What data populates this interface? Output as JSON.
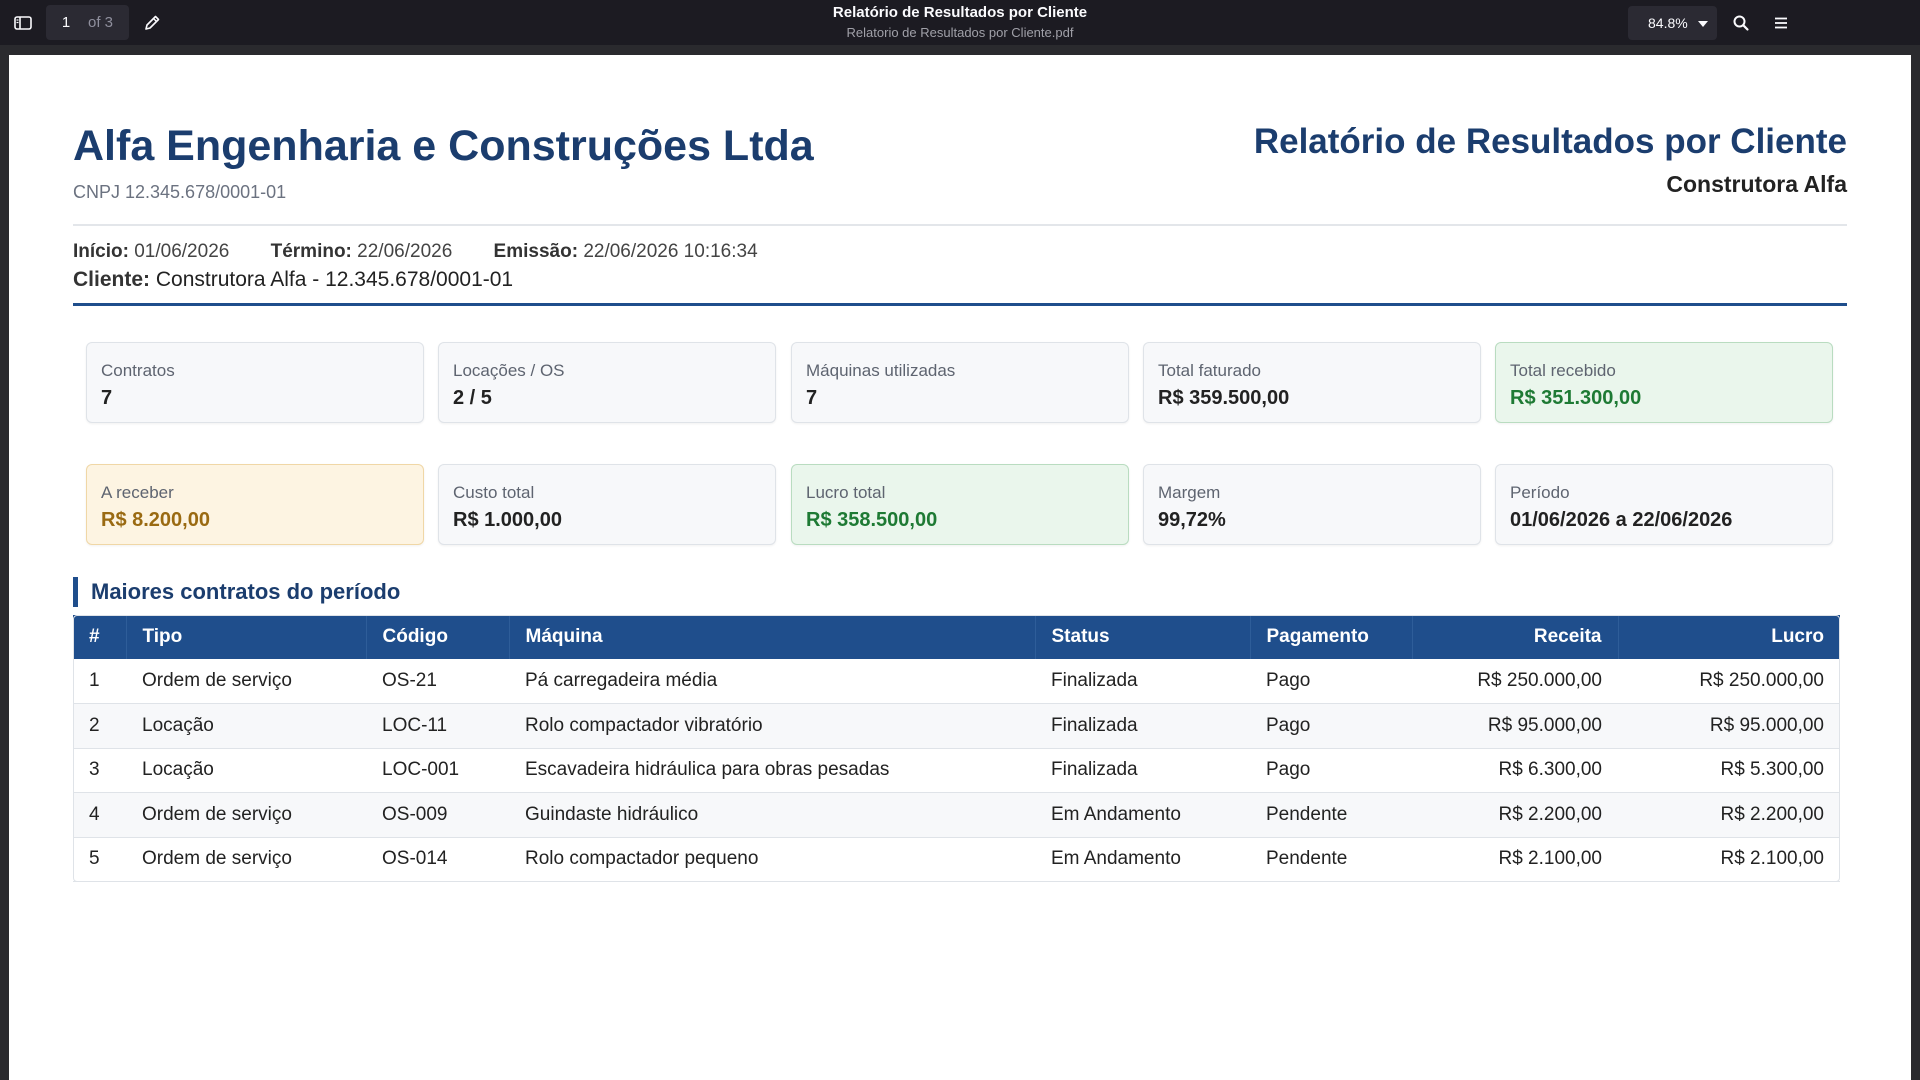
{
  "toolbar": {
    "page_current": "1",
    "page_total_label": "of 3",
    "title": "Relatório de Resultados por Cliente",
    "filename": "Relatorio de Resultados por Cliente.pdf",
    "zoom": "84.8%",
    "icons": {
      "sidebar": "sidebar-toggle-icon",
      "edit": "pencil-icon",
      "search": "search-icon",
      "menu": "hamburger-menu-icon"
    }
  },
  "report": {
    "company_name": "Alfa Engenharia e Construções Ltda",
    "company_cnpj": "CNPJ 12.345.678/0001-01",
    "title": "Relatório de Resultados por Cliente",
    "client_short": "Construtora Alfa",
    "meta": {
      "start_label": "Início:",
      "start_value": "01/06/2026",
      "end_label": "Término:",
      "end_value": "22/06/2026",
      "issued_label": "Emissão:",
      "issued_value": "22/06/2026 10:16:34",
      "client_label": "Cliente:",
      "client_value": "Construtora Alfa - 12.345.678/0001-01"
    },
    "cards": [
      {
        "label": "Contratos",
        "value": "7"
      },
      {
        "label": "Locações / OS",
        "value": "2 / 5"
      },
      {
        "label": "Máquinas utilizadas",
        "value": "7"
      },
      {
        "label": "Total faturado",
        "value": "R$ 359.500,00"
      },
      {
        "label": "Total recebido",
        "value": "R$ 351.300,00"
      },
      {
        "label": "A receber",
        "value": "R$ 8.200,00"
      },
      {
        "label": "Custo total",
        "value": "R$ 1.000,00"
      },
      {
        "label": "Lucro total",
        "value": "R$ 358.500,00"
      },
      {
        "label": "Margem",
        "value": "99,72%"
      },
      {
        "label": "Período",
        "value": "01/06/2026 a 22/06/2026"
      }
    ],
    "section_title": "Maiores contratos do período",
    "table": {
      "headers": [
        "#",
        "Tipo",
        "Código",
        "Máquina",
        "Status",
        "Pagamento",
        "Receita",
        "Lucro"
      ],
      "rows": [
        [
          "1",
          "Ordem de serviço",
          "OS-21",
          "Pá carregadeira média",
          "Finalizada",
          "Pago",
          "R$ 250.000,00",
          "R$ 250.000,00"
        ],
        [
          "2",
          "Locação",
          "LOC-11",
          "Rolo compactador vibratório",
          "Finalizada",
          "Pago",
          "R$ 95.000,00",
          "R$ 95.000,00"
        ],
        [
          "3",
          "Locação",
          "LOC-001",
          "Escavadeira hidráulica para obras pesadas",
          "Finalizada",
          "Pago",
          "R$ 6.300,00",
          "R$ 5.300,00"
        ],
        [
          "4",
          "Ordem de serviço",
          "OS-009",
          "Guindaste hidráulico",
          "Em Andamento",
          "Pendente",
          "R$ 2.200,00",
          "R$ 2.200,00"
        ],
        [
          "5",
          "Ordem de serviço",
          "OS-014",
          "Rolo compactador pequeno",
          "Em Andamento",
          "Pendente",
          "R$ 2.100,00",
          "R$ 2.100,00"
        ]
      ]
    }
  }
}
